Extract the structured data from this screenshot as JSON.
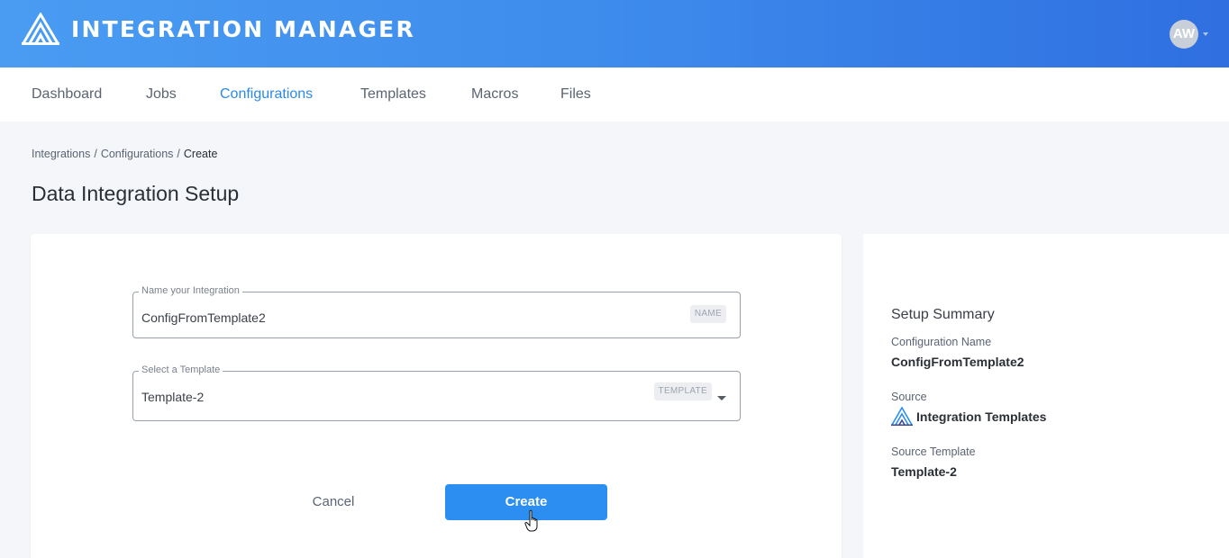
{
  "header": {
    "app_title": "INTEGRATION MANAGER",
    "logo_icon": "triangle-logo-icon",
    "user_initials": "AW",
    "brand_color": "#3d8bec"
  },
  "nav": {
    "items": [
      {
        "label": "Dashboard",
        "active": false
      },
      {
        "label": "Jobs",
        "active": false
      },
      {
        "label": "Configurations",
        "active": true
      },
      {
        "label": "Templates",
        "active": false
      },
      {
        "label": "Macros",
        "active": false
      },
      {
        "label": "Files",
        "active": false
      }
    ],
    "active_color": "#2b8ae6"
  },
  "breadcrumb": {
    "items": [
      "Integrations",
      "Configurations",
      "Create"
    ],
    "separator": "/"
  },
  "page_title": "Data Integration Setup",
  "form": {
    "name_field": {
      "label": "Name your Integration",
      "value": "ConfigFromTemplate2",
      "tag": "NAME"
    },
    "template_field": {
      "label": "Select a Template",
      "value": "Template-2",
      "tag": "TEMPLATE"
    },
    "cancel_label": "Cancel",
    "create_label": "Create",
    "create_color": "#2b8ef0"
  },
  "summary": {
    "title": "Setup Summary",
    "config_name_label": "Configuration Name",
    "config_name_value": "ConfigFromTemplate2",
    "source_label": "Source",
    "source_value": "Integration Templates",
    "source_icon": "triangle-logo-icon",
    "source_template_label": "Source Template",
    "source_template_value": "Template-2"
  }
}
